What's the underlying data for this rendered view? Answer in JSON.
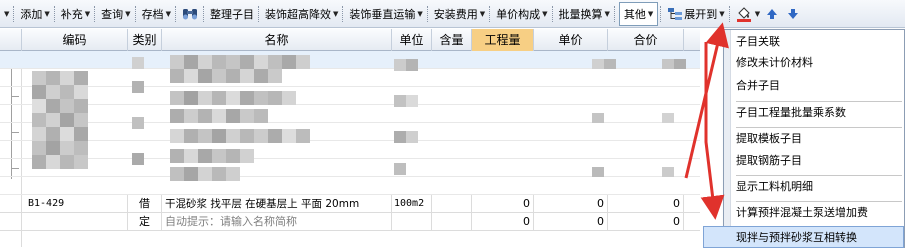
{
  "toolbar": {
    "items": [
      {
        "label": "添加"
      },
      {
        "label": "补充"
      },
      {
        "label": "查询"
      },
      {
        "label": "存档"
      },
      {
        "label": "整理子目"
      },
      {
        "label": "装饰超高降效"
      },
      {
        "label": "装饰垂直运输"
      },
      {
        "label": "安装费用"
      },
      {
        "label": "单价构成"
      },
      {
        "label": "批量换算"
      },
      {
        "label": "其他"
      },
      {
        "label": "展开到"
      }
    ]
  },
  "grid": {
    "columns": [
      "编码",
      "类别",
      "名称",
      "单位",
      "含量",
      "工程量",
      "单价",
      "合价"
    ],
    "highlighted_column": "工程量",
    "rows": [
      {
        "code": "B1-429",
        "type": "借",
        "name": "干混砂浆 找平层 在硬基层上 平面 20mm",
        "unit": "100m2",
        "content": "",
        "quantity": "0",
        "price": "0",
        "total": "0"
      },
      {
        "code": "",
        "type": "定",
        "name": "自动提示：请输入名称简称",
        "unit": "",
        "content": "",
        "quantity": "0",
        "price": "0",
        "total": "0"
      }
    ]
  },
  "menu": {
    "items": [
      {
        "label": "子目关联"
      },
      {
        "label": "修改未计价材料"
      },
      {
        "label": "合并子目"
      },
      {
        "label": "子目工程量批量乘系数"
      },
      {
        "label": "提取模板子目"
      },
      {
        "label": "提取钢筋子目"
      },
      {
        "label": "显示工料机明细"
      },
      {
        "label": "计算预拌混凝土泵送增加费"
      },
      {
        "label": "现拌与预拌砂浆互相转换"
      }
    ],
    "hovered_item": "现拌与预拌砂浆互相转换"
  },
  "colors": {
    "annotation_arrow": "#e0322c",
    "header_highlight": "#f7cf84",
    "menu_hover": "#d3e5fb"
  }
}
